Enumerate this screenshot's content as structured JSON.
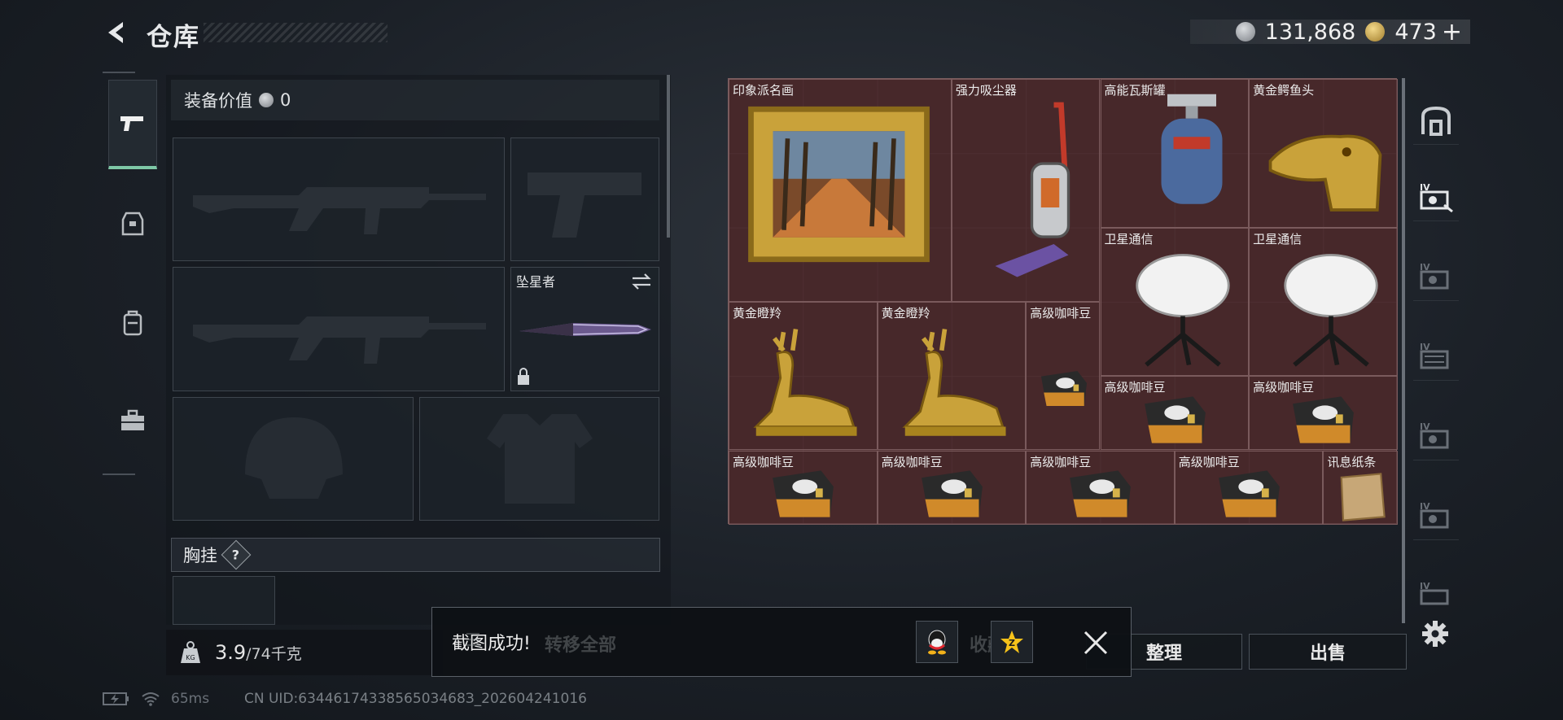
{
  "header": {
    "title": "仓库",
    "currency": {
      "coins": "131,868",
      "gold": "473",
      "plus": "+"
    }
  },
  "equipment": {
    "value_label": "装备价值",
    "value": "0",
    "melee_name": "坠星者",
    "chest_label": "胸挂",
    "chest_help": "?",
    "weight_current": "3.9",
    "weight_max": "/74千克"
  },
  "grid": {
    "items": [
      {
        "name": "印象派名画",
        "icon": "painting-icon"
      },
      {
        "name": "强力吸尘器",
        "icon": "vacuum-icon"
      },
      {
        "name": "高能瓦斯罐",
        "icon": "gas-can-icon"
      },
      {
        "name": "黄金鳄鱼头",
        "icon": "gold-croc-icon"
      },
      {
        "name": "卫星通信",
        "icon": "satellite-dish-icon"
      },
      {
        "name": "卫星通信",
        "icon": "satellite-dish-icon"
      },
      {
        "name": "黄金瞪羚",
        "icon": "gold-gazelle-icon"
      },
      {
        "name": "黄金瞪羚",
        "icon": "gold-gazelle-icon"
      },
      {
        "name": "高级咖啡豆",
        "icon": "coffee-bag-icon"
      },
      {
        "name": "高级咖啡豆",
        "icon": "coffee-bag-icon"
      },
      {
        "name": "高级咖啡豆",
        "icon": "coffee-bag-icon"
      },
      {
        "name": "高级咖啡豆",
        "icon": "coffee-bag-icon"
      },
      {
        "name": "高级咖啡豆",
        "icon": "coffee-bag-icon"
      },
      {
        "name": "高级咖啡豆",
        "icon": "coffee-bag-icon"
      },
      {
        "name": "高级咖啡豆",
        "icon": "coffee-bag-icon"
      },
      {
        "name": "讯息纸条",
        "icon": "note-paper-icon"
      }
    ]
  },
  "actions": {
    "transfer_all": "转移全部",
    "collect": "收藏",
    "sort": "整理",
    "sell": "出售"
  },
  "toast": {
    "message": "截图成功!"
  },
  "status": {
    "ping": "65ms",
    "uid": "CN UID:6344617433856503468З_202604241016"
  },
  "colors": {
    "accent": "#7ec8a6",
    "grid_bg": "#4a2a2c"
  }
}
